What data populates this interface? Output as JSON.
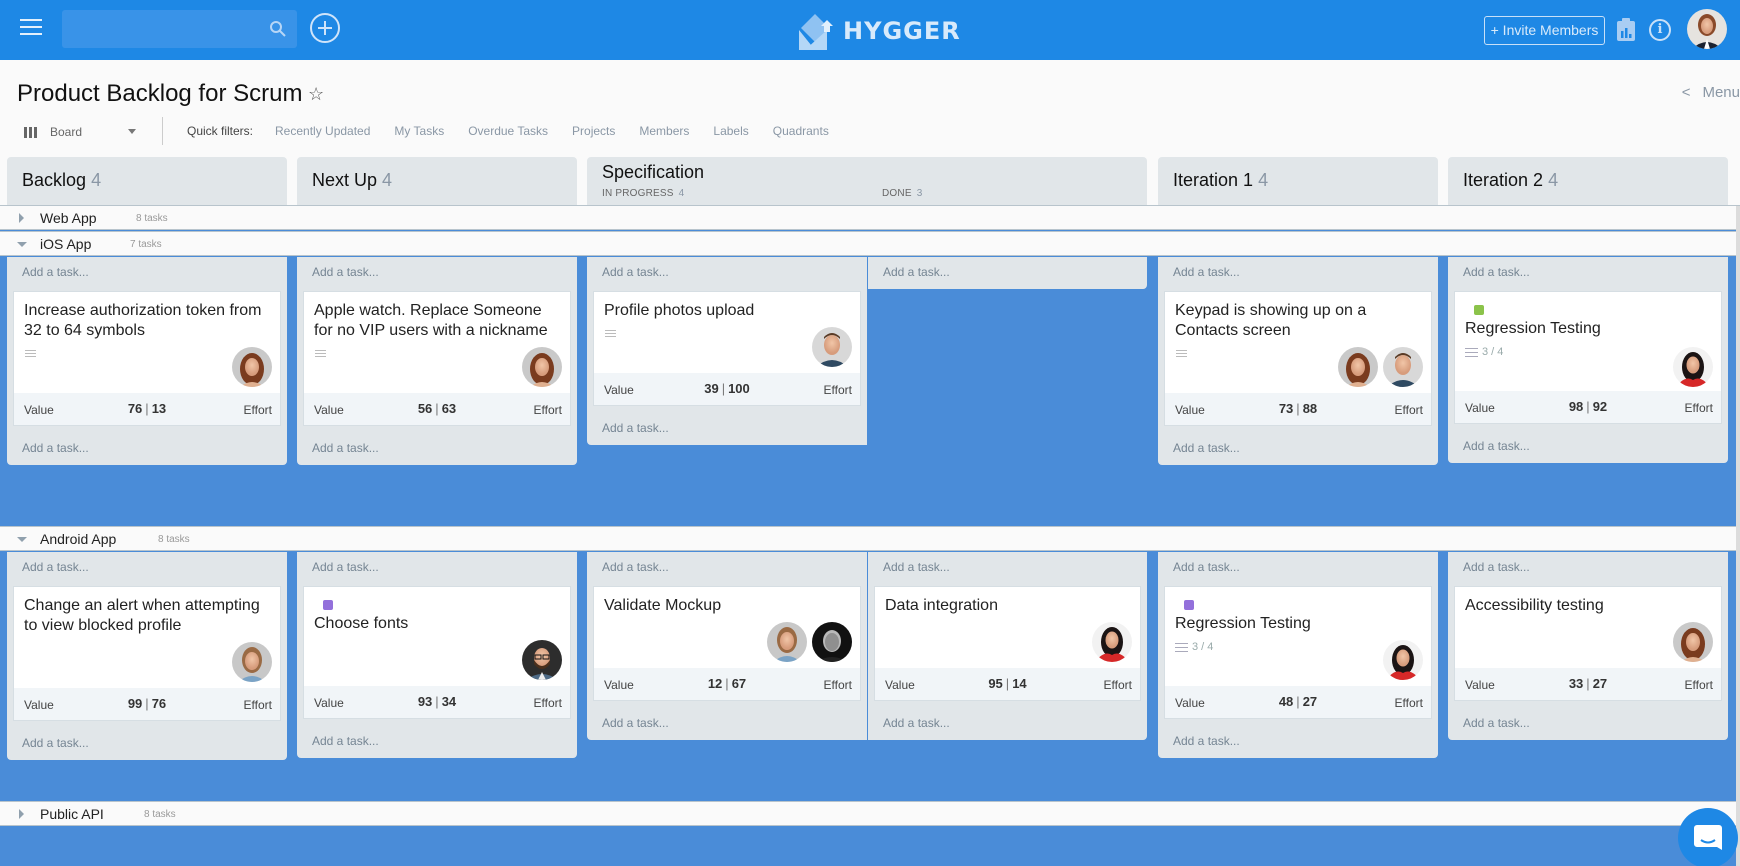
{
  "app": {
    "brand": "HYGGER",
    "accent": "#1e88e5",
    "board_bg": "#4a8cd8"
  },
  "topbar": {
    "search_placeholder": "",
    "search_value": "",
    "invite_label": "+ Invite Members",
    "info_glyph": "i",
    "icons": [
      "menu-icon",
      "search-icon",
      "add-icon",
      "report-icon",
      "info-icon",
      "user-avatar"
    ]
  },
  "page": {
    "title": "Product Backlog for Scrum",
    "star_glyph": "☆",
    "menu_label": "Menu",
    "menu_chevron": "<",
    "view_label": "Board",
    "quick_filters_label": "Quick filters:",
    "quick_filters": [
      "Recently Updated",
      "My Tasks",
      "Overdue Tasks",
      "Projects",
      "Members",
      "Labels",
      "Quadrants"
    ]
  },
  "columns": [
    {
      "title": "Backlog",
      "count": "4"
    },
    {
      "title": "Next Up",
      "count": "4"
    },
    {
      "title": "Specification",
      "sub": [
        {
          "title": "IN PROGRESS",
          "count": "4"
        },
        {
          "title": "DONE",
          "count": "3"
        }
      ]
    },
    {
      "title": "Iteration 1",
      "count": "4"
    },
    {
      "title": "Iteration 2",
      "count": "4"
    }
  ],
  "swimlanes": [
    {
      "name": "Web App",
      "tasks": "8 tasks",
      "expanded": false
    },
    {
      "name": "iOS App",
      "tasks": "7 tasks",
      "expanded": true
    },
    {
      "name": "Android App",
      "tasks": "8 tasks",
      "expanded": true
    },
    {
      "name": "Public API",
      "tasks": "8 tasks",
      "expanded": false
    }
  ],
  "add_task_label": "Add a task...",
  "card_labels": {
    "value": "Value",
    "effort": "Effort",
    "pipe": "|"
  },
  "ios_cards": {
    "backlog": {
      "title": "Increase authorization token from 32 to 64 symbols",
      "value": "76",
      "effort": "13",
      "has_description": true,
      "assignees": [
        "woman-brown-hair"
      ]
    },
    "next_up": {
      "title": "Apple watch. Replace Someone for no VIP users with a nickname",
      "value": "56",
      "effort": "63",
      "has_description": true,
      "assignees": [
        "woman-brown-hair"
      ]
    },
    "spec_in_progress": {
      "title": "Profile photos upload",
      "value": "39",
      "effort": "100",
      "has_description": true,
      "assignees": [
        "man-smiling"
      ]
    },
    "iteration_1": {
      "title": "Keypad is showing up on a Contacts screen",
      "value": "73",
      "effort": "88",
      "has_description": true,
      "assignees": [
        "woman-brown-hair",
        "man-smiling"
      ]
    },
    "iteration_2": {
      "title": "Regression Testing",
      "value": "98",
      "effort": "92",
      "label_color": "#8bc34a",
      "checklist": "3 / 4",
      "assignees": [
        "woman-dark-hair-red"
      ]
    }
  },
  "android_cards": {
    "backlog": {
      "title": "Change an alert when attempting to view blocked profile",
      "value": "99",
      "effort": "76",
      "assignees": [
        "woman-blonde"
      ]
    },
    "next_up": {
      "title": "Choose fonts",
      "value": "93",
      "effort": "34",
      "label_color": "#9370db",
      "assignees": [
        "man-beard-glasses"
      ]
    },
    "spec_in_progress": {
      "title": "Validate Mockup",
      "value": "12",
      "effort": "67",
      "assignees": [
        "woman-blonde",
        "man-bw"
      ]
    },
    "spec_done": {
      "title": "Data integration",
      "value": "95",
      "effort": "14",
      "assignees": [
        "woman-dark-hair-red"
      ]
    },
    "iteration_1": {
      "title": "Regression Testing",
      "value": "48",
      "effort": "27",
      "label_color": "#9370db",
      "checklist": "3 / 4",
      "assignees": [
        "woman-dark-hair-red"
      ]
    },
    "iteration_2": {
      "title": "Accessibility testing",
      "value": "33",
      "effort": "27",
      "assignees": [
        "woman-brown-hair"
      ]
    }
  }
}
